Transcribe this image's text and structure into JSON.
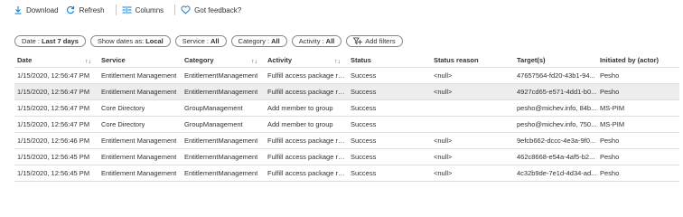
{
  "toolbar": {
    "download": "Download",
    "refresh": "Refresh",
    "columns": "Columns",
    "feedback": "Got feedback?"
  },
  "filters": [
    {
      "label": "Date :",
      "value": "Last 7 days"
    },
    {
      "label": "Show dates as:",
      "value": "Local"
    },
    {
      "label": "Service :",
      "value": "All"
    },
    {
      "label": "Category :",
      "value": "All"
    },
    {
      "label": "Activity :",
      "value": "All"
    }
  ],
  "add_filters": "Add filters",
  "columns": {
    "date": "Date",
    "service": "Service",
    "category": "Category",
    "activity": "Activity",
    "status": "Status",
    "reason": "Status reason",
    "target": "Target(s)",
    "initiated": "Initiated by (actor)"
  },
  "rows": [
    {
      "date": "1/15/2020, 12:56:47 PM",
      "service": "Entitlement Management",
      "category": "EntitlementManagement",
      "activity": "Fulfill access package res...",
      "status": "Success",
      "reason": "<null>",
      "target": "47657564-fd20-43b1-94...",
      "initiated": "Pesho",
      "selected": false
    },
    {
      "date": "1/15/2020, 12:56:47 PM",
      "service": "Entitlement Management",
      "category": "EntitlementManagement",
      "activity": "Fulfill access package res...",
      "status": "Success",
      "reason": "<null>",
      "target": "4927cd65-e571-4dd1-b0...",
      "initiated": "Pesho",
      "selected": true
    },
    {
      "date": "1/15/2020, 12:56:47 PM",
      "service": "Core Directory",
      "category": "GroupManagement",
      "activity": "Add member to group",
      "status": "Success",
      "reason": "",
      "target": "pesho@michev.info, 84b...",
      "initiated": "MS-PIM",
      "selected": false
    },
    {
      "date": "1/15/2020, 12:56:47 PM",
      "service": "Core Directory",
      "category": "GroupManagement",
      "activity": "Add member to group",
      "status": "Success",
      "reason": "",
      "target": "pesho@michev.info, 750...",
      "initiated": "MS-PIM",
      "selected": false
    },
    {
      "date": "1/15/2020, 12:56:46 PM",
      "service": "Entitlement Management",
      "category": "EntitlementManagement",
      "activity": "Fulfill access package res...",
      "status": "Success",
      "reason": "<null>",
      "target": "9efcb662-dccc-4e3a-9f0...",
      "initiated": "Pesho",
      "selected": false
    },
    {
      "date": "1/15/2020, 12:56:45 PM",
      "service": "Entitlement Management",
      "category": "EntitlementManagement",
      "activity": "Fulfill access package res...",
      "status": "Success",
      "reason": "<null>",
      "target": "462c8668-e54a-4af5-b2...",
      "initiated": "Pesho",
      "selected": false
    },
    {
      "date": "1/15/2020, 12:56:45 PM",
      "service": "Entitlement Management",
      "category": "EntitlementManagement",
      "activity": "Fulfill access package res...",
      "status": "Success",
      "reason": "<null>",
      "target": "4c32b9de-7e1d-4d34-ad...",
      "initiated": "Pesho",
      "selected": false
    }
  ],
  "colors": {
    "accent": "#0078d4",
    "selected_row": "#ededed",
    "border": "#e1dfdd"
  },
  "icons": [
    "download-icon",
    "refresh-icon",
    "columns-icon",
    "feedback-heart-icon",
    "add-filter-icon",
    "sort-icon"
  ]
}
